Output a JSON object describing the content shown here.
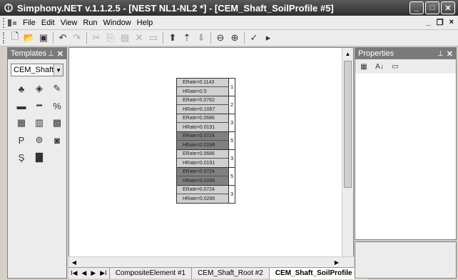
{
  "window": {
    "title": "Simphony.NET v.1.1.2.5 - [NEST NL1-NL2 *] - [CEM_Shaft_SoilProfile #5]",
    "min": "_",
    "max": "□",
    "close": "✕"
  },
  "menu": {
    "items": [
      "File",
      "Edit",
      "View",
      "Run",
      "Window",
      "Help"
    ],
    "mdi_min": "_",
    "mdi_restore": "❐",
    "mdi_close": "×"
  },
  "toolbar": {
    "icons": [
      "new-icon",
      "open-icon",
      "save-icon",
      "undo-icon",
      "redo-icon",
      "cut-icon",
      "copy-icon",
      "paste-icon",
      "delete-icon",
      "properties-icon",
      "move-up-icon",
      "move-up-alt-icon",
      "move-down-icon",
      "zoom-out-icon",
      "zoom-in-icon",
      "check-icon",
      "run-icon"
    ]
  },
  "templates": {
    "title": "Templates",
    "pin": "⊥",
    "close": "✕",
    "selected": "CEM_Shaft"
  },
  "properties": {
    "title": "Properties",
    "pin": "⊥",
    "close": "✕"
  },
  "soil_profile": {
    "layers": [
      {
        "erate": "ERate=0.1143",
        "hrate": "HRate=0.5",
        "n": "1",
        "color": "#d0d0d0"
      },
      {
        "erate": "ERate=0.0762",
        "hrate": "HRate=0.1067",
        "n": "2",
        "color": "#d0d0d0"
      },
      {
        "erate": "ERate=0.0686",
        "hrate": "HRate=0.0191",
        "n": "3",
        "color": "#d0d0d0"
      },
      {
        "erate": "ERate=0.0724",
        "hrate": "HRate=0.0286",
        "n": "5",
        "color": "#808080"
      },
      {
        "erate": "ERate=0.0686",
        "hrate": "HRate=0.0191",
        "n": "3",
        "color": "#d0d0d0"
      },
      {
        "erate": "ERate=0.0724",
        "hrate": "HRate=0.0286",
        "n": "5",
        "color": "#808080"
      },
      {
        "erate": "ERate=0.0724",
        "hrate": "HRate=0.0286",
        "n": "3",
        "color": "#d0d0d0"
      }
    ]
  },
  "tabs": [
    {
      "label": "CompositeElement #1",
      "active": false
    },
    {
      "label": "CEM_Shaft_Root #2",
      "active": false
    },
    {
      "label": "CEM_Shaft_SoilProfile #5",
      "active": true
    }
  ]
}
